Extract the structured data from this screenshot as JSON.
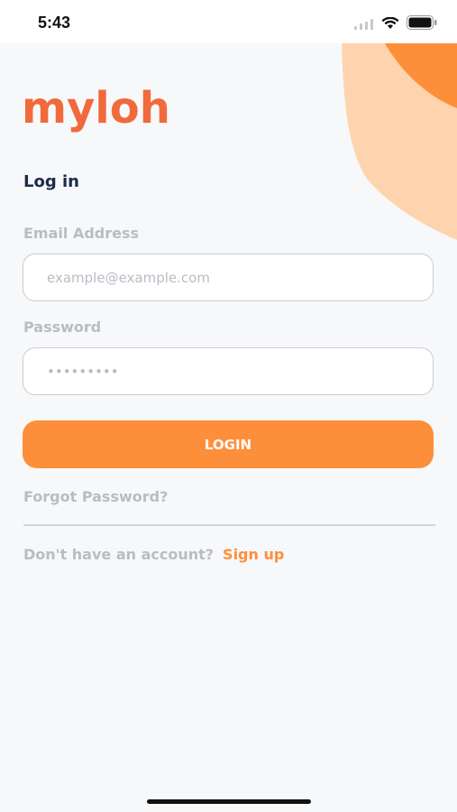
{
  "status_bar": {
    "time": "5:43"
  },
  "brand": {
    "logo_text": "myloh",
    "logo_color": "#f16a3c",
    "accent": "#fd8f3a"
  },
  "form": {
    "heading": "Log in",
    "email_label": "Email Address",
    "email_placeholder": "example@example.com",
    "password_label": "Password",
    "password_placeholder": "•••••••••",
    "login_label": "LOGIN",
    "forgot_label": "Forgot Password?"
  },
  "footer": {
    "no_account_text": "Don't have an account?",
    "signup_label": "Sign up"
  },
  "icons": [
    "signal-icon",
    "wifi-icon",
    "battery-icon"
  ]
}
